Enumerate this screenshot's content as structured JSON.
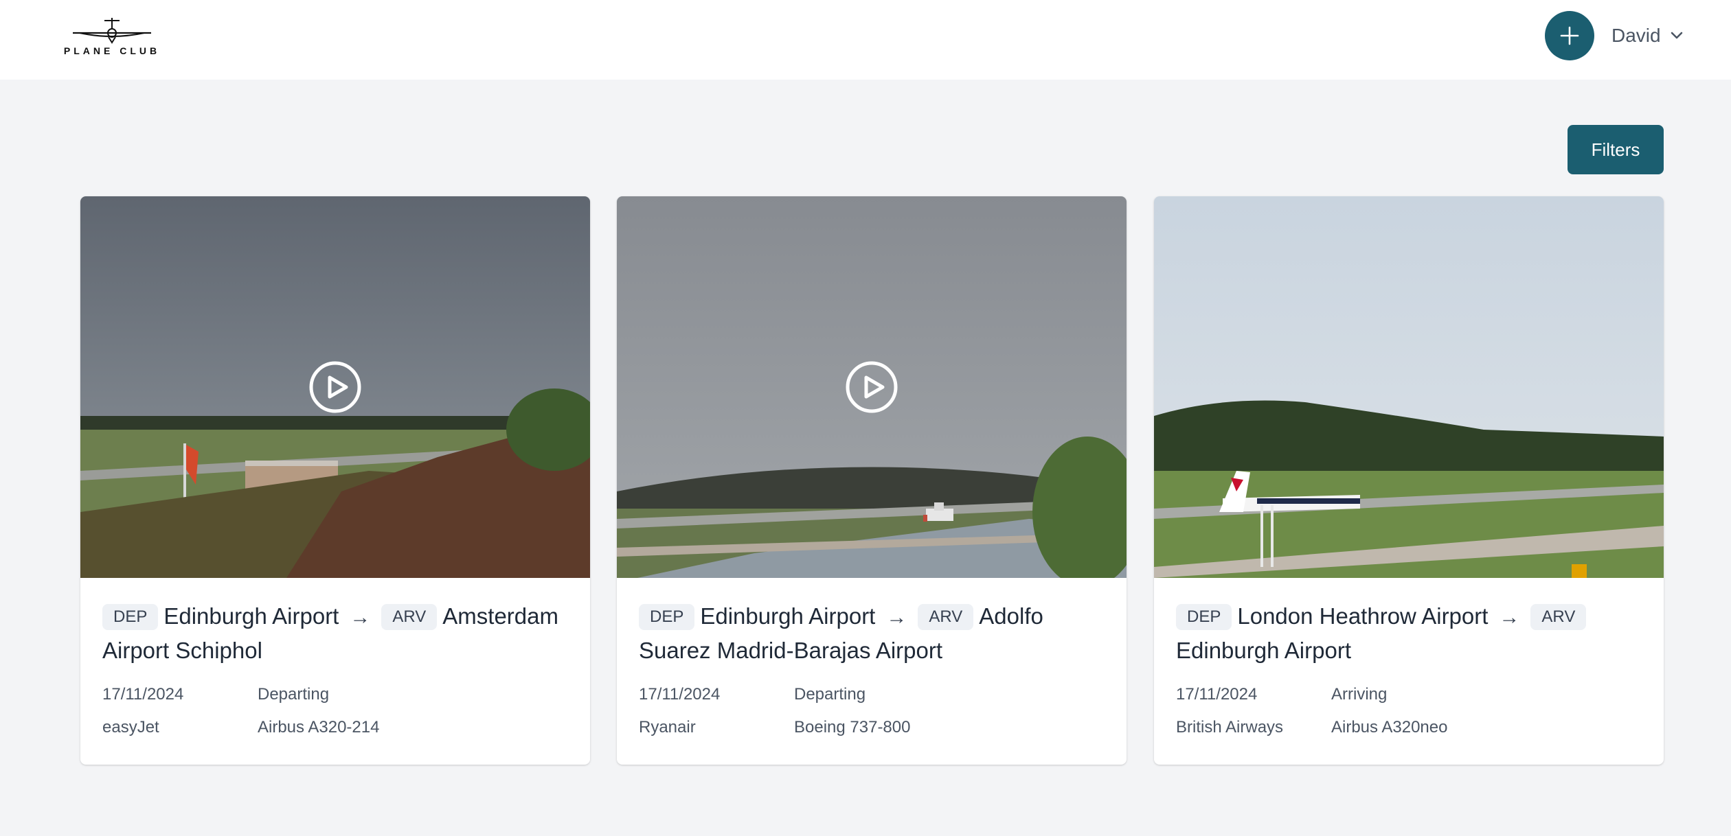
{
  "header": {
    "logo_text": "PLANE CLUB",
    "logo_icon": "plane-logo-icon",
    "add_icon": "plus-icon",
    "user_name": "David",
    "user_chevron_icon": "chevron-down-icon"
  },
  "toolbar": {
    "filters_label": "Filters"
  },
  "colors": {
    "accent": "#1b5e70",
    "background": "#f3f4f6",
    "badge_bg": "#eef1f5"
  },
  "cards": [
    {
      "has_video": true,
      "dep_badge": "DEP",
      "dep_airport": "Edinburgh Airport",
      "arrow": "→",
      "arv_badge": "ARV",
      "arv_airport": "Amsterdam Airport Schiphol",
      "date": "17/11/2024",
      "status": "Departing",
      "airline": "easyJet",
      "aircraft": "Airbus A320-214"
    },
    {
      "has_video": true,
      "dep_badge": "DEP",
      "dep_airport": "Edinburgh Airport",
      "arrow": "→",
      "arv_badge": "ARV",
      "arv_airport": "Adolfo Suarez Madrid-Barajas Airport",
      "date": "17/11/2024",
      "status": "Departing",
      "airline": "Ryanair",
      "aircraft": "Boeing 737-800"
    },
    {
      "has_video": false,
      "dep_badge": "DEP",
      "dep_airport": "London Heathrow Airport",
      "arrow": "→",
      "arv_badge": "ARV",
      "arv_airport": "Edinburgh Airport",
      "date": "17/11/2024",
      "status": "Arriving",
      "airline": "British Airways",
      "aircraft": "Airbus A320neo"
    }
  ]
}
